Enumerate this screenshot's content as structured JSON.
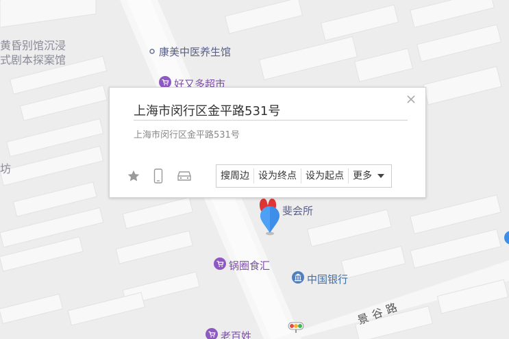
{
  "map": {
    "pois": [
      {
        "name": "黄昏别馆沉浸",
        "style": "gray"
      },
      {
        "name": "式剧本探案馆",
        "style": "gray"
      },
      {
        "name": "康美中医养生馆",
        "style": "normal"
      },
      {
        "name": "好又多超市",
        "style": "purple"
      },
      {
        "name": "坊",
        "style": "gray"
      },
      {
        "name": "斐会所",
        "style": "normal"
      },
      {
        "name": "锅圈食汇",
        "style": "purple"
      },
      {
        "name": "中国银行",
        "style": "blue"
      },
      {
        "name": "老百姓",
        "style": "purple"
      }
    ],
    "road": "景谷路",
    "colors": {
      "background": "#ededed",
      "block": "#ffffff",
      "road": "#e3e3e3",
      "marker": "#3d8ee8",
      "marker_red": "#e03535",
      "shop_icon": "#8e59c2",
      "bank_icon": "#4f7fbf"
    }
  },
  "popup": {
    "title": "上海市闵行区金平路531号",
    "address": "上海市闵行区金平路531号",
    "icons": [
      "star-icon",
      "phone-icon",
      "car-icon"
    ],
    "actions": [
      "搜周边",
      "设为终点",
      "设为起点",
      "更多"
    ],
    "close_icon": "close-icon"
  }
}
